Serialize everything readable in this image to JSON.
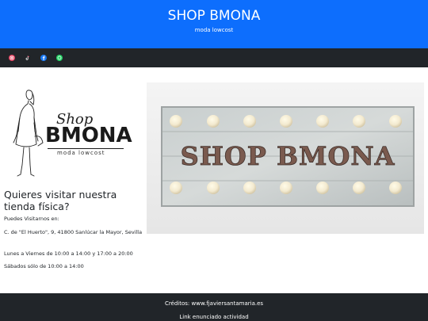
{
  "header": {
    "title": "SHOP BMONA",
    "subtitle": "moda lowcost"
  },
  "social": [
    {
      "icon": "instagram-icon"
    },
    {
      "icon": "tiktok-icon"
    },
    {
      "icon": "facebook-icon"
    },
    {
      "icon": "whatsapp-icon"
    }
  ],
  "logo": {
    "shop": "Shop",
    "brand": "BMONA",
    "tagline": "moda lowcost"
  },
  "store": {
    "title": "Quieres visitar nuestra tienda física?",
    "intro": "Puedes Visitarnos en:",
    "address": "C. de \"El Huerto\", 9, 41800 Sanlúcar la Mayor, Sevilla",
    "hours_weekday": "Lunes a Viernes de 10:00 a 14:00 y 17:00 a 20:00",
    "hours_saturday": "Sábados sólo de 10:00 a 14:00"
  },
  "photo": {
    "sign_text": "SHOP BMONA"
  },
  "footer": {
    "credits": "Créditos: www.fjaviersantamaria.es",
    "link": "Link enunciado actividad"
  },
  "colors": {
    "header_bg": "#0d6efd",
    "bar_bg": "#212529",
    "footer_bg": "#212529"
  }
}
